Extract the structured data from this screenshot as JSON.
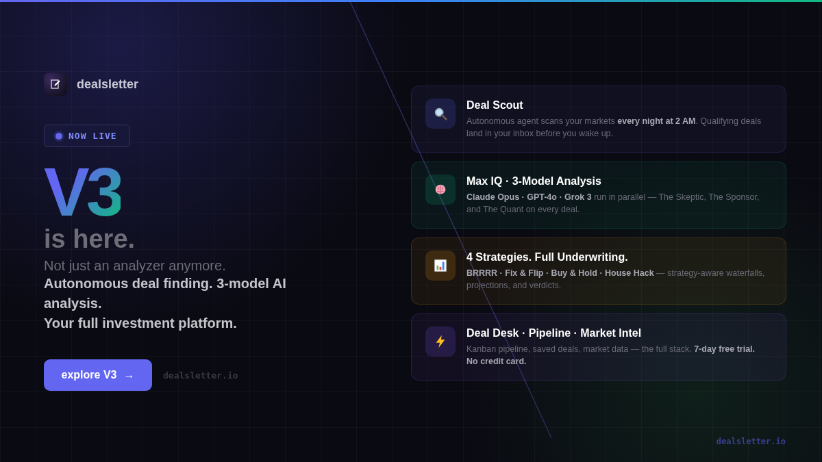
{
  "brand": {
    "name": "dealsletter"
  },
  "badge": {
    "label": "NOW LIVE"
  },
  "hero": {
    "version": "V3",
    "headline": "is here.",
    "tagline": "Not just an analyzer anymore.",
    "lines": [
      "Autonomous deal finding. 3-model AI analysis.",
      "Your full investment platform."
    ]
  },
  "cta": {
    "label": "explore V3",
    "arrow": "→",
    "url": "dealsletter.io"
  },
  "features": [
    {
      "kind": "scout",
      "title": "Deal Scout",
      "text": "Autonomous agent scans your markets **every night at 2 AM**. Qualifying deals land in your inbox before you wake up."
    },
    {
      "kind": "analysis",
      "title": "Max IQ · 3-Model Analysis",
      "text": "**Claude Opus · GPT-4o · Grok 3** run in parallel — The Skeptic, The Sponsor, and The Quant on every deal."
    },
    {
      "kind": "strategies",
      "title": "4 Strategies. Full Underwriting.",
      "text": "**BRRRR · Fix & Flip · Buy & Hold · House Hack** — strategy-aware waterfalls, projections, and verdicts."
    },
    {
      "kind": "desk",
      "title": "Deal Desk · Pipeline · Market Intel",
      "text": "Kanban pipeline, saved deals, market data — the full stack. **7-day free trial. No credit card.**"
    }
  ],
  "footer": {
    "url": "dealsletter.io"
  }
}
